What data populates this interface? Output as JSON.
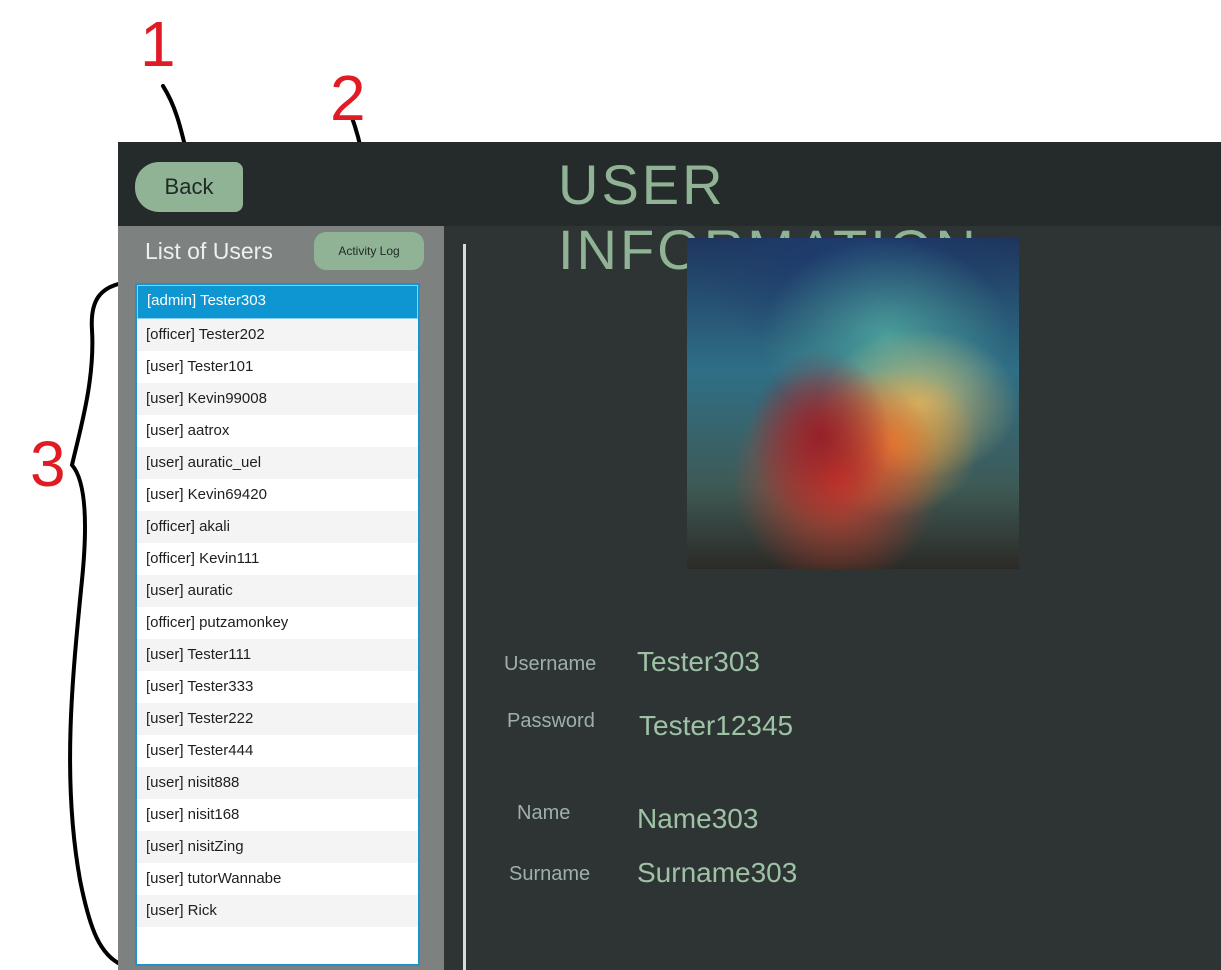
{
  "annotations": [
    "1",
    "2",
    "3"
  ],
  "header": {
    "back_label": "Back",
    "title": "USER INFORMATION"
  },
  "sidebar": {
    "title": "List of Users",
    "activity_log_label": "Activity Log",
    "users": [
      "[admin] Tester303",
      "[officer] Tester202",
      "[user] Tester101",
      "[user] Kevin99008",
      "[user] aatrox",
      "[user] auratic_uel",
      "[user] Kevin69420",
      "[officer] akali",
      "[officer] Kevin111",
      "[user] auratic",
      "[officer] putzamonkey",
      "[user] Tester111",
      "[user] Tester333",
      "[user] Tester222",
      "[user] Tester444",
      "[user] nisit888",
      "[user] nisit168",
      "[user] nisitZing",
      "[user] tutorWannabe",
      "[user] Rick"
    ],
    "selected_index": 0
  },
  "details": {
    "username_label": "Username",
    "username_value": "Tester303",
    "password_label": "Password",
    "password_value": "Tester12345",
    "name_label": "Name",
    "name_value": "Name303",
    "surname_label": "Surname",
    "surname_value": "Surname303"
  },
  "colors": {
    "accent": "#8fb394",
    "header_bg": "#252b2a",
    "panel_bg": "#2d3433",
    "sidebar_bg": "#7d8180",
    "selection": "#0d96d1",
    "annotation": "#e01b24"
  }
}
